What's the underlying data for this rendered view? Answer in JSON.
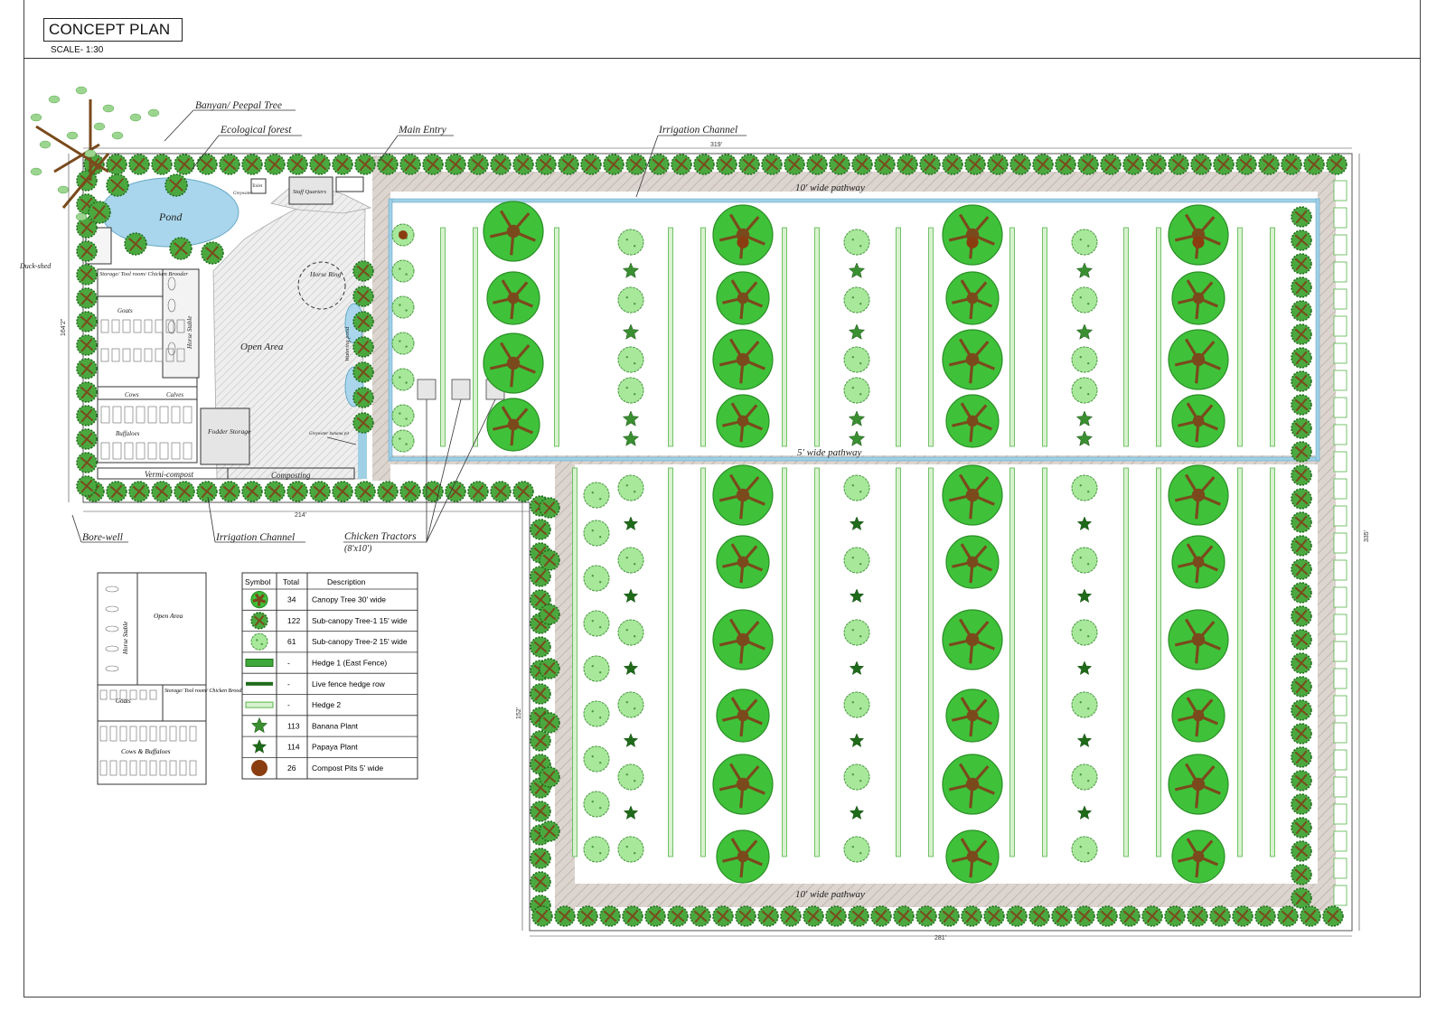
{
  "header": {
    "title": "CONCEPT PLAN",
    "scale": "SCALE- 1:30"
  },
  "labels": {
    "banyan": "Banyan/ Peepal Tree",
    "ecological_forest": "Ecological forest",
    "main_entry": "Main Entry",
    "irrigation_channel_top": "Irrigation Channel",
    "pond": "Pond",
    "duck_shed": "Duck-shed",
    "greywater_top": "Greywater",
    "toilet": "Toilet",
    "staff_quarters": "Staff Quarters",
    "storage": "Storage/ Tool room/ Chicken Brooder",
    "goats": "Goats",
    "horse_stable": "Horse Stable",
    "cows": "Cows",
    "calves": "Calves",
    "buffaloes": "Buffaloes",
    "fodder_storage": "Fodder Storage",
    "open_area": "Open Area",
    "horse_ring": "Horse Ring",
    "watering_pond": "Watering pond",
    "greywater_banana": "Greywater banana pit",
    "vermi_compost": "Vermi-compost",
    "composting": "Composting",
    "pathway_10_top": "10' wide pathway",
    "pathway_5": "5' wide pathway",
    "pathway_10_bottom": "10' wide pathway",
    "bore_well": "Bore-well",
    "irrigation_channel_bottom": "Irrigation Channel",
    "chicken_tractors": "Chicken Tractors",
    "chicken_tractors_size": "(8'x10')"
  },
  "dimensions": {
    "top": "319'",
    "left": "164'2\"",
    "bottom_left": "214'",
    "right": "335'",
    "bottom": "281'",
    "lower_left": "152'"
  },
  "inset": {
    "open_area": "Open Area",
    "horse_stable": "Horse Stable",
    "goats": "Goats",
    "storage": "Storage/ Tool room/ Chicken Brooder",
    "cows_buffaloes": "Cows & Buffaloes"
  },
  "legend": {
    "headers": [
      "Symbol",
      "Total",
      "Description"
    ],
    "rows": [
      {
        "symbol": "canopy-tree",
        "total": "34",
        "description": "Canopy Tree 30' wide"
      },
      {
        "symbol": "subcanopy-tree-1",
        "total": "122",
        "description": "Sub-canopy Tree-1 15' wide"
      },
      {
        "symbol": "subcanopy-tree-2",
        "total": "61",
        "description": "Sub-canopy Tree-2 15' wide"
      },
      {
        "symbol": "hedge-1",
        "total": "-",
        "description": "Hedge 1 (East Fence)"
      },
      {
        "symbol": "live-fence",
        "total": "-",
        "description": "Live fence hedge row"
      },
      {
        "symbol": "hedge-2",
        "total": "-",
        "description": "Hedge 2"
      },
      {
        "symbol": "banana",
        "total": "113",
        "description": "Banana Plant"
      },
      {
        "symbol": "papaya",
        "total": "114",
        "description": "Papaya Plant"
      },
      {
        "symbol": "compost-pit",
        "total": "26",
        "description": "Compost Pits 5' wide"
      }
    ]
  },
  "colors": {
    "tree_green": "#3fc23a",
    "light_tree": "#a8e89b",
    "trunk_brown": "#7a4a1c",
    "dark_leaf": "#1f6b1a",
    "water": "#a9d6ec",
    "path": "#d9d2cc",
    "fence": "#2e8b2a"
  }
}
